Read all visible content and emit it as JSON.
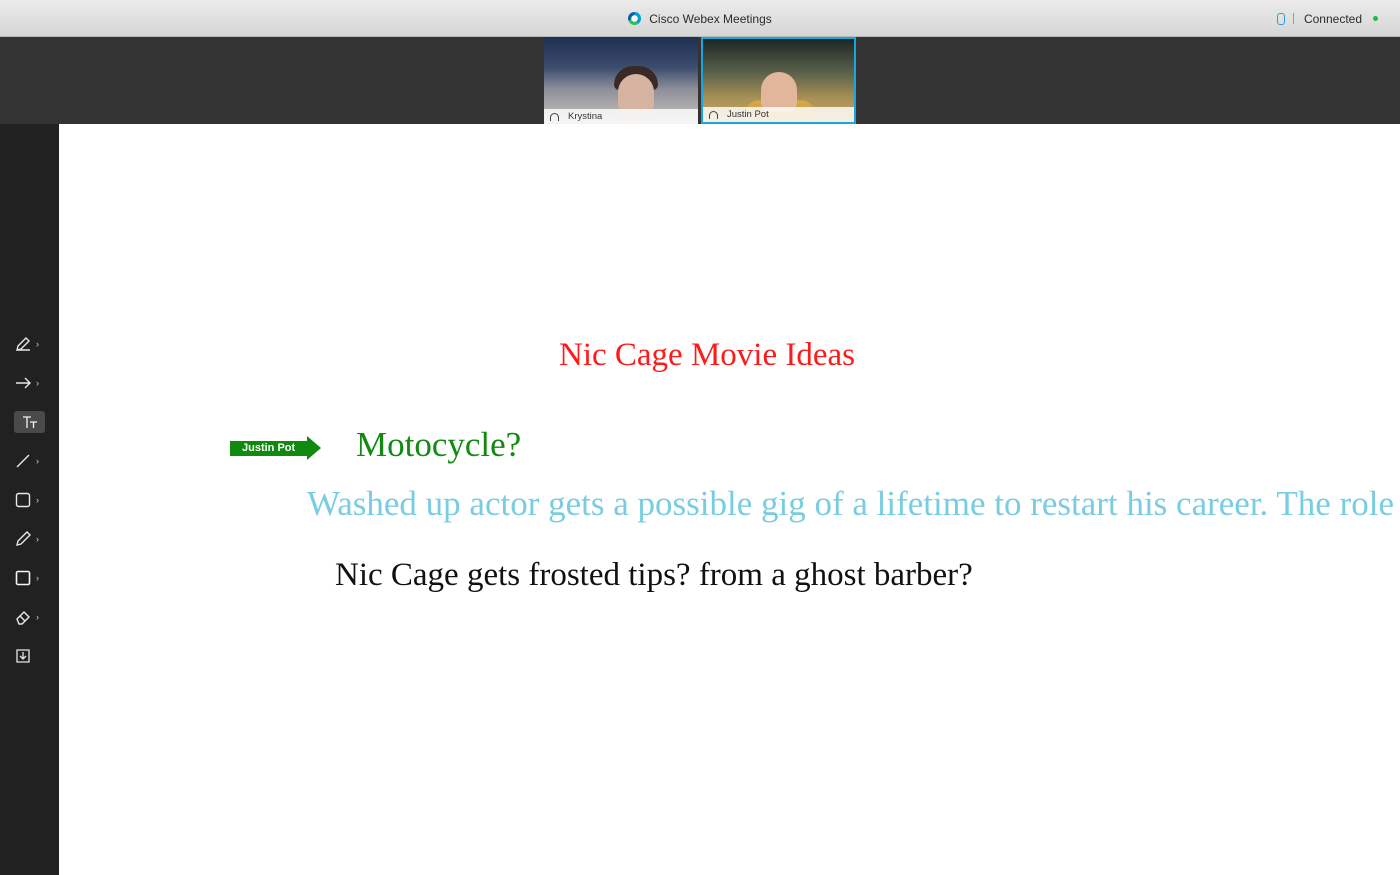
{
  "window": {
    "title": "Cisco Webex Meetings",
    "status": "Connected"
  },
  "participants": [
    {
      "name": "Krystina"
    },
    {
      "name": "Justin Pot"
    }
  ],
  "toolbar": {
    "tools": [
      {
        "icon": "annotate-pen-icon"
      },
      {
        "icon": "pointer-arrow-icon"
      },
      {
        "icon": "text-tool-icon",
        "active": true
      },
      {
        "icon": "line-tool-icon"
      },
      {
        "icon": "rectangle-tool-icon"
      },
      {
        "icon": "pencil-tool-icon"
      },
      {
        "icon": "color-square-icon"
      },
      {
        "icon": "eraser-icon"
      },
      {
        "icon": "save-download-icon"
      }
    ]
  },
  "whiteboard": {
    "title": "Nic Cage Movie Ideas",
    "cursor_label": "Justin Pot",
    "lines": [
      "Motocycle?",
      "Washed up actor gets a possible gig of a lifetime to restart his career. The role",
      "Nic Cage gets frosted tips? from a ghost barber?"
    ]
  },
  "colors": {
    "title": "#ff1a1a",
    "green": "#108a10",
    "light_blue": "#79cde2",
    "black": "#111111",
    "active_tile_border": "#18a5e0",
    "toolbar_bg": "#212121"
  }
}
